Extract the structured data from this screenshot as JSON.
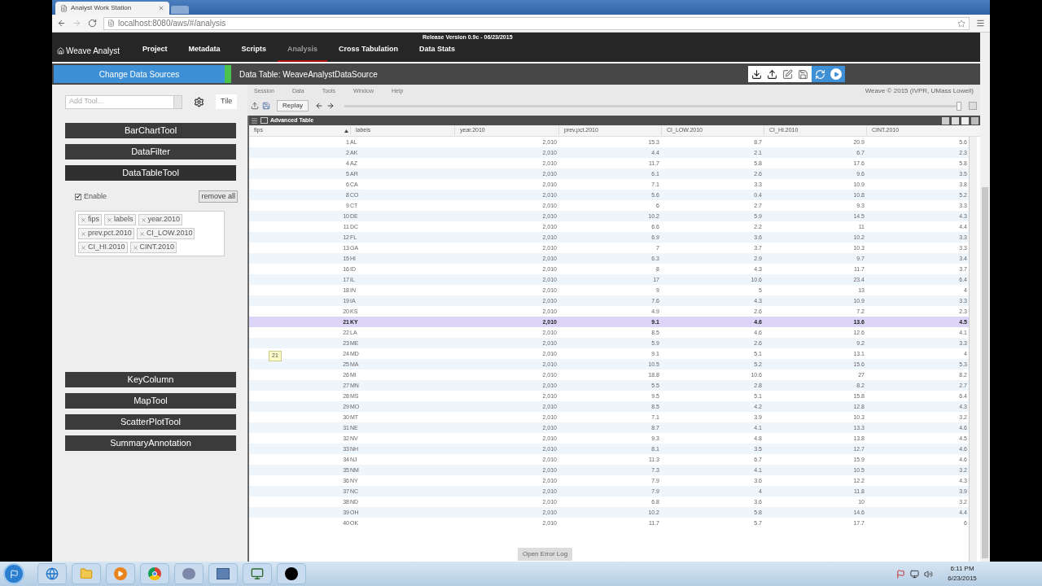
{
  "browser": {
    "tab_title": "Analyst Work Station",
    "url": "localhost:8080/aws/#/analysis"
  },
  "app_nav": {
    "brand": "Weave Analyst",
    "release": "Release Version 0.9c - 06/23/2015",
    "items": [
      {
        "label": "Project",
        "selected": false
      },
      {
        "label": "Metadata",
        "selected": false
      },
      {
        "label": "Scripts",
        "selected": false
      },
      {
        "label": "Analysis",
        "selected": true
      },
      {
        "label": "Cross Tabulation",
        "selected": false
      },
      {
        "label": "Data Stats",
        "selected": false
      }
    ]
  },
  "data_bar": {
    "button": "Change Data Sources",
    "title": "Data Table: WeaveAnalystDataSource"
  },
  "left_panel": {
    "add_tool_placeholder": "Add Tool...",
    "tile_button": "Tile",
    "tools": [
      {
        "label": "BarChartTool",
        "expanded": false
      },
      {
        "label": "DataFilter",
        "expanded": false
      },
      {
        "label": "DataTableTool",
        "expanded": true,
        "enable_label": "Enable",
        "enabled": true,
        "remove_all": "remove all",
        "columns": [
          "fips",
          "labels",
          "year.2010",
          "prev.pct.2010",
          "CI_LOW.2010",
          "CI_HI.2010",
          "CINT.2010"
        ]
      },
      {
        "label": "KeyColumn",
        "expanded": false
      },
      {
        "label": "MapTool",
        "expanded": false
      },
      {
        "label": "ScatterPlotTool",
        "expanded": false
      },
      {
        "label": "SummaryAnnotation",
        "expanded": false
      }
    ]
  },
  "weave": {
    "menu": [
      "Session",
      "Data",
      "Tools",
      "Window",
      "Help"
    ],
    "copyright": "Weave © 2015 (IVPR, UMass Lowell)",
    "replay_button": "Replay",
    "replay_slider": {
      "level": 1
    },
    "table": {
      "title": "Advanced Table",
      "columns": [
        "fips",
        "labels",
        "year.2010",
        "prev.pct.2010",
        "CI_LOW.2010",
        "CI_HI.2010",
        "CINT.2010"
      ],
      "tooltip": "21",
      "rows": [
        {
          "cells": [
            "1",
            "AL",
            "2,010",
            "15.3",
            "8.7",
            "20.9",
            "5.6"
          ],
          "selected": false
        },
        {
          "cells": [
            "2",
            "AK",
            "2,010",
            "4.4",
            "2.1",
            "6.7",
            "2.3"
          ],
          "selected": false
        },
        {
          "cells": [
            "4",
            "AZ",
            "2,010",
            "11.7",
            "5.8",
            "17.6",
            "5.8"
          ],
          "selected": false
        },
        {
          "cells": [
            "5",
            "AR",
            "2,010",
            "6.1",
            "2.6",
            "9.6",
            "3.5"
          ],
          "selected": false
        },
        {
          "cells": [
            "6",
            "CA",
            "2,010",
            "7.1",
            "3.3",
            "10.9",
            "3.8"
          ],
          "selected": false
        },
        {
          "cells": [
            "8",
            "CO",
            "2,010",
            "5.6",
            "0.4",
            "10.8",
            "5.2"
          ],
          "selected": false
        },
        {
          "cells": [
            "9",
            "CT",
            "2,010",
            "6",
            "2.7",
            "9.3",
            "3.3"
          ],
          "selected": false
        },
        {
          "cells": [
            "10",
            "DE",
            "2,010",
            "10.2",
            "5.9",
            "14.5",
            "4.3"
          ],
          "selected": false
        },
        {
          "cells": [
            "11",
            "DC",
            "2,010",
            "6.6",
            "2.2",
            "11",
            "4.4"
          ],
          "selected": false
        },
        {
          "cells": [
            "12",
            "FL",
            "2,010",
            "6.9",
            "3.6",
            "10.2",
            "3.3"
          ],
          "selected": false
        },
        {
          "cells": [
            "13",
            "GA",
            "2,010",
            "7",
            "3.7",
            "10.3",
            "3.3"
          ],
          "selected": false
        },
        {
          "cells": [
            "15",
            "HI",
            "2,010",
            "6.3",
            "2.9",
            "9.7",
            "3.4"
          ],
          "selected": false
        },
        {
          "cells": [
            "16",
            "ID",
            "2,010",
            "8",
            "4.3",
            "11.7",
            "3.7"
          ],
          "selected": false
        },
        {
          "cells": [
            "17",
            "IL",
            "2,010",
            "17",
            "10.6",
            "23.4",
            "6.4"
          ],
          "selected": false
        },
        {
          "cells": [
            "18",
            "IN",
            "2,010",
            "9",
            "5",
            "13",
            "4"
          ],
          "selected": false
        },
        {
          "cells": [
            "19",
            "IA",
            "2,010",
            "7.6",
            "4.3",
            "10.9",
            "3.3"
          ],
          "selected": false
        },
        {
          "cells": [
            "20",
            "KS",
            "2,010",
            "4.9",
            "2.6",
            "7.2",
            "2.3"
          ],
          "selected": false
        },
        {
          "cells": [
            "21",
            "KY",
            "2,010",
            "9.1",
            "4.6",
            "13.6",
            "4.5"
          ],
          "selected": true
        },
        {
          "cells": [
            "22",
            "LA",
            "2,010",
            "8.5",
            "4.6",
            "12.6",
            "4.1"
          ],
          "selected": false
        },
        {
          "cells": [
            "23",
            "ME",
            "2,010",
            "5.9",
            "2.6",
            "9.2",
            "3.3"
          ],
          "selected": false
        },
        {
          "cells": [
            "24",
            "MD",
            "2,010",
            "9.1",
            "5.1",
            "13.1",
            "4"
          ],
          "selected": false
        },
        {
          "cells": [
            "25",
            "MA",
            "2,010",
            "10.5",
            "5.2",
            "15.6",
            "5.3"
          ],
          "selected": false
        },
        {
          "cells": [
            "26",
            "MI",
            "2,010",
            "18.8",
            "10.6",
            "27",
            "8.2"
          ],
          "selected": false
        },
        {
          "cells": [
            "27",
            "MN",
            "2,010",
            "5.5",
            "2.8",
            "8.2",
            "2.7"
          ],
          "selected": false
        },
        {
          "cells": [
            "28",
            "MS",
            "2,010",
            "9.5",
            "5.1",
            "15.8",
            "6.4"
          ],
          "selected": false
        },
        {
          "cells": [
            "29",
            "MO",
            "2,010",
            "8.5",
            "4.2",
            "12.8",
            "4.3"
          ],
          "selected": false
        },
        {
          "cells": [
            "30",
            "MT",
            "2,010",
            "7.1",
            "3.9",
            "10.3",
            "3.2"
          ],
          "selected": false
        },
        {
          "cells": [
            "31",
            "NE",
            "2,010",
            "8.7",
            "4.1",
            "13.3",
            "4.6"
          ],
          "selected": false
        },
        {
          "cells": [
            "32",
            "NV",
            "2,010",
            "9.3",
            "4.8",
            "13.8",
            "4.5"
          ],
          "selected": false
        },
        {
          "cells": [
            "33",
            "NH",
            "2,010",
            "8.1",
            "3.5",
            "12.7",
            "4.6"
          ],
          "selected": false
        },
        {
          "cells": [
            "34",
            "NJ",
            "2,010",
            "11.3",
            "6.7",
            "15.9",
            "4.6"
          ],
          "selected": false
        },
        {
          "cells": [
            "35",
            "NM",
            "2,010",
            "7.3",
            "4.1",
            "10.5",
            "3.2"
          ],
          "selected": false
        },
        {
          "cells": [
            "36",
            "NY",
            "2,010",
            "7.9",
            "3.6",
            "12.2",
            "4.3"
          ],
          "selected": false
        },
        {
          "cells": [
            "37",
            "NC",
            "2,010",
            "7.9",
            "4",
            "11.8",
            "3.9"
          ],
          "selected": false
        },
        {
          "cells": [
            "38",
            "ND",
            "2,010",
            "6.8",
            "3.6",
            "10",
            "3.2"
          ],
          "selected": false
        },
        {
          "cells": [
            "39",
            "OH",
            "2,010",
            "10.2",
            "5.8",
            "14.6",
            "4.4"
          ],
          "selected": false
        },
        {
          "cells": [
            "40",
            "OK",
            "2,010",
            "11.7",
            "5.7",
            "17.7",
            "6"
          ],
          "selected": false
        }
      ]
    },
    "error_log_button": "Open Error Log"
  },
  "taskbar": {
    "time": "6:11 PM",
    "date": "6/23/2015"
  }
}
